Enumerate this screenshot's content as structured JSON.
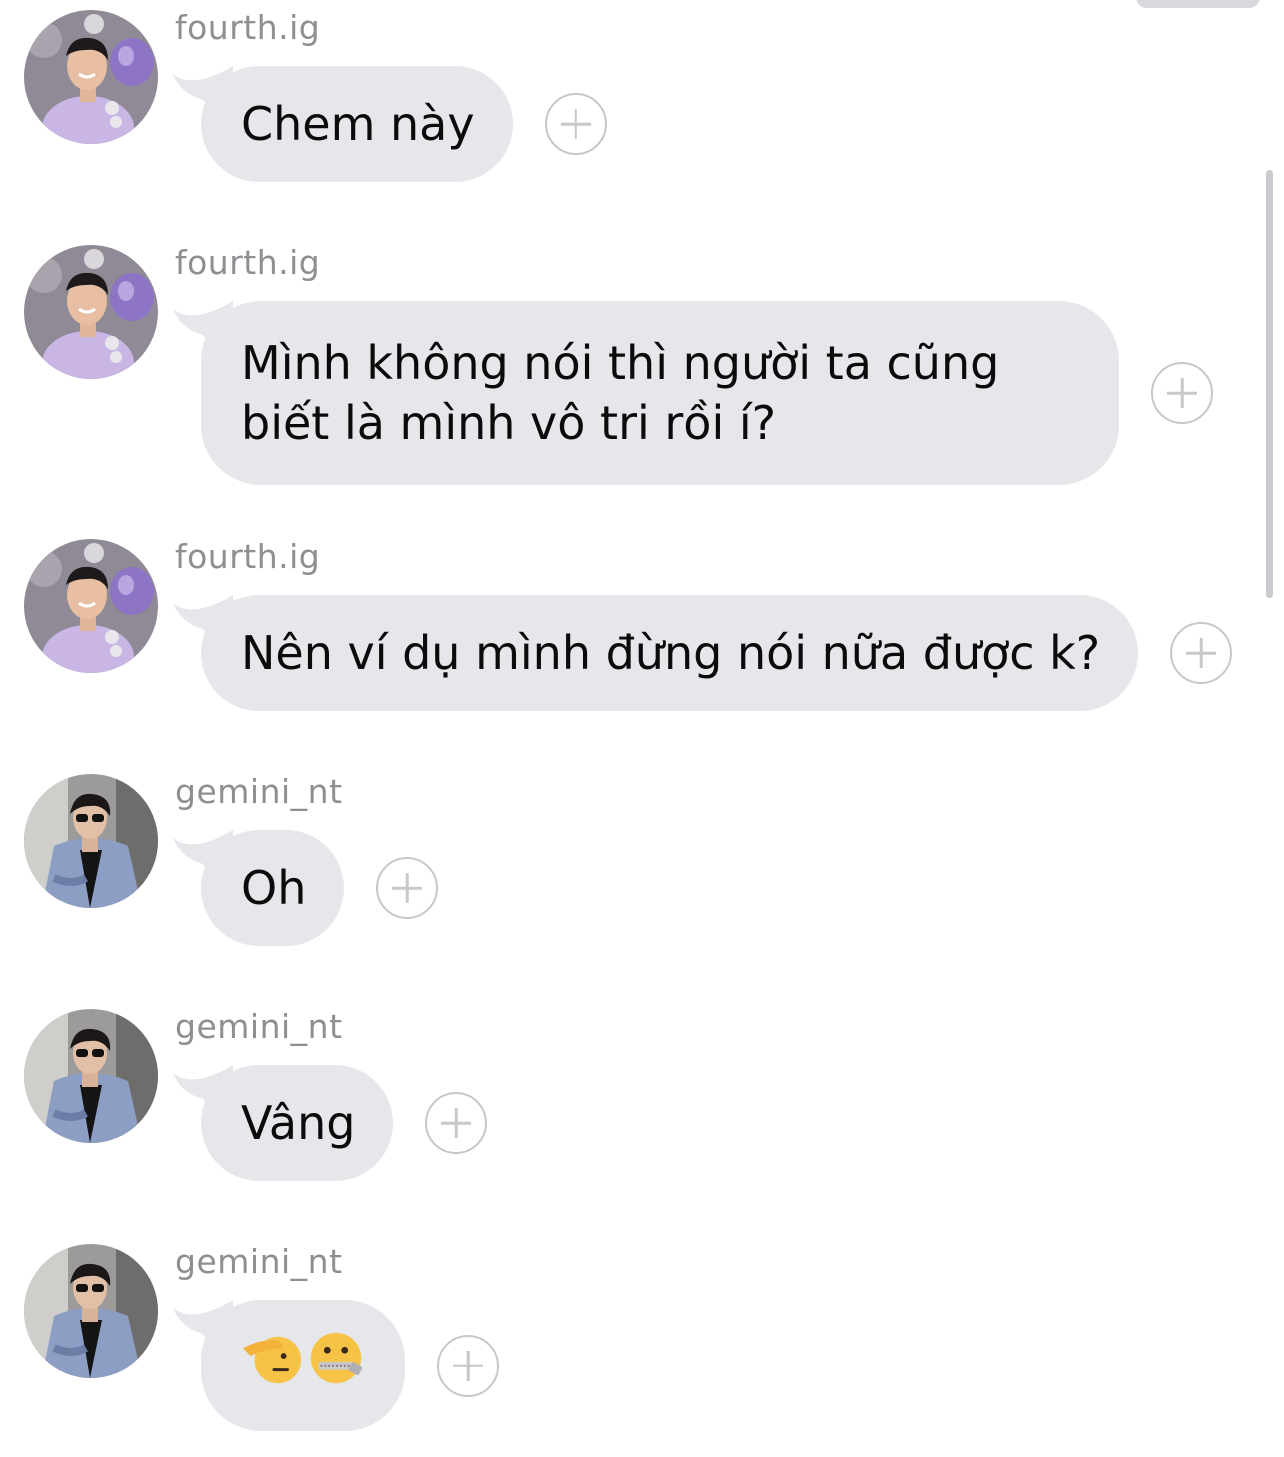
{
  "messages": [
    {
      "sender": "fourth.ig",
      "avatar": "avatar-fourth",
      "text": "Chem này"
    },
    {
      "sender": "fourth.ig",
      "avatar": "avatar-fourth",
      "text": "Mình không nói thì người ta cũng biết là mình vô tri rồi í?"
    },
    {
      "sender": "fourth.ig",
      "avatar": "avatar-fourth",
      "text": "Nên ví dụ mình đừng nói nữa được k?"
    },
    {
      "sender": "gemini_nt",
      "avatar": "avatar-gemini",
      "text": "Oh"
    },
    {
      "sender": "gemini_nt",
      "avatar": "avatar-gemini",
      "text": "Vâng"
    },
    {
      "sender": "gemini_nt",
      "avatar": "avatar-gemini",
      "emoji": [
        "saluting-face-emoji",
        "zipper-mouth-face-emoji"
      ]
    }
  ],
  "colors": {
    "bubble": "#e5e7ea",
    "sender_text": "#8e8e93",
    "message_text": "#0b0b0c",
    "add_button": "#c7c7cc"
  }
}
